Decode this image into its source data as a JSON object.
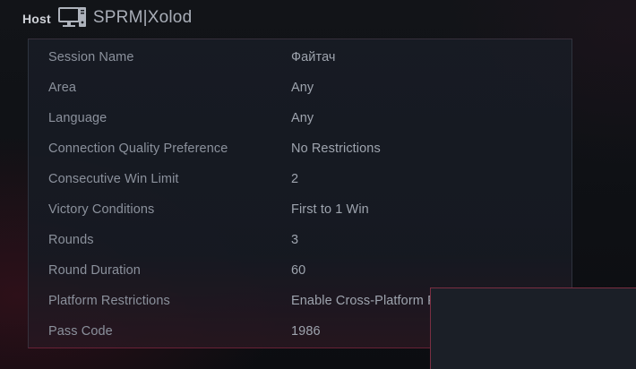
{
  "header": {
    "host_label": "Host",
    "host_icon": "computer-monitor-icon",
    "host_name": "SPRM|Xolod"
  },
  "session": {
    "rows": [
      {
        "label": "Session Name",
        "value": "Файтач"
      },
      {
        "label": "Area",
        "value": "Any"
      },
      {
        "label": "Language",
        "value": "Any"
      },
      {
        "label": "Connection Quality Preference",
        "value": "No Restrictions"
      },
      {
        "label": "Consecutive Win Limit",
        "value": "2"
      },
      {
        "label": "Victory Conditions",
        "value": "First to 1 Win"
      },
      {
        "label": "Rounds",
        "value": "3"
      },
      {
        "label": "Round Duration",
        "value": "60"
      },
      {
        "label": "Platform Restrictions",
        "value": "Enable Cross-Platform Pl"
      },
      {
        "label": "Pass Code",
        "value": "1986"
      }
    ]
  },
  "colors": {
    "accent": "#c0304f",
    "panel_bg": "#181c24",
    "label_text": "#8b919c",
    "value_text": "#9ea4ae"
  }
}
